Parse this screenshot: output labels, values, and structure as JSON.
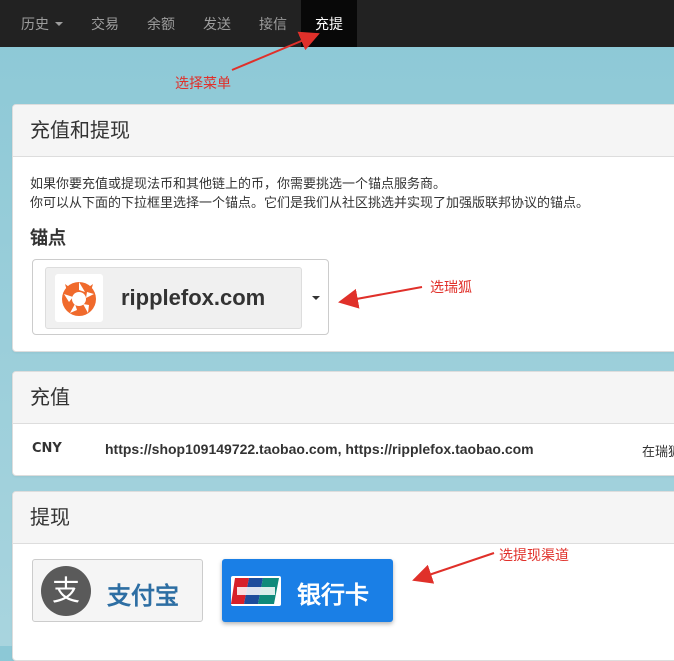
{
  "nav": {
    "items": [
      {
        "label": "历史",
        "dropdown": true
      },
      {
        "label": "交易"
      },
      {
        "label": "余额"
      },
      {
        "label": "发送"
      },
      {
        "label": "接信"
      },
      {
        "label": "充提",
        "active": true
      }
    ]
  },
  "deposit_withdraw": {
    "title": "充值和提现",
    "desc_line1": "如果你要充值或提现法币和其他链上的币，你需要挑选一个锚点服务商。",
    "desc_line2": "你可以从下面的下拉框里选择一个锚点。它们是我们从社区挑选并实现了加强版联邦协议的锚点。",
    "anchor_label": "锚点",
    "anchor_selected": "ripplefox.com"
  },
  "deposit": {
    "title": "充值",
    "rows": [
      {
        "currency": "CNY",
        "urls": "https://shop109149722.taobao.com, https://ripplefox.taobao.com",
        "info": "在瑞狐"
      }
    ]
  },
  "withdraw": {
    "title": "提现",
    "alipay_label": "支付宝",
    "alipay_glyph": "支",
    "bank_label": "银行卡"
  },
  "annotations": {
    "menu": "选择菜单",
    "fox": "选瑞狐",
    "channel": "选提现渠道"
  },
  "colors": {
    "annotation": "#e0302a",
    "bank_button": "#1a7fe6",
    "alipay_text": "#2d6ea3",
    "fox_orange": "#f06a2c"
  }
}
